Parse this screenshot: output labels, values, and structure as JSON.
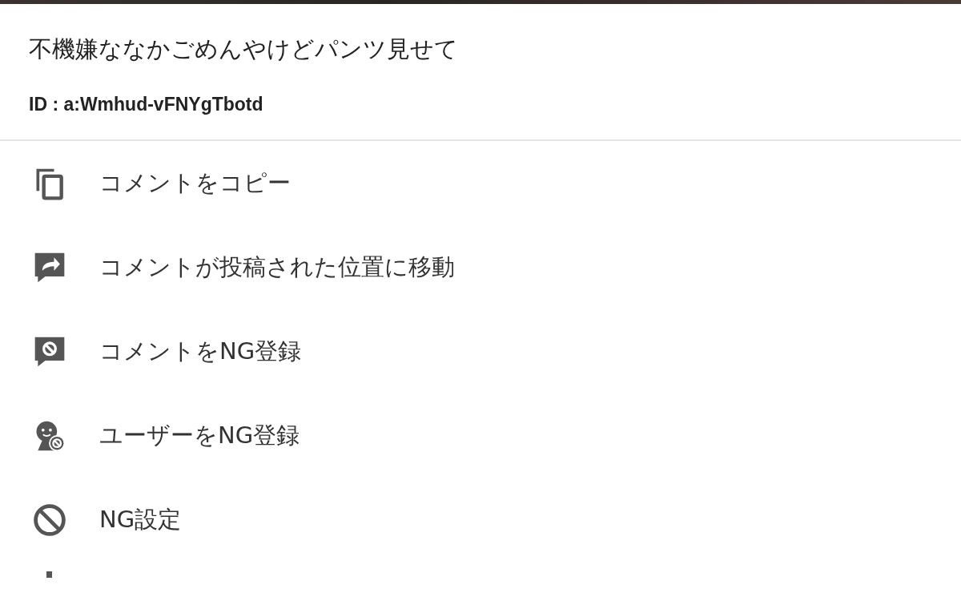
{
  "comment": {
    "text": "不機嫌ななかごめんやけどパンツ見せて",
    "id": "ID : a:Wmhud-vFNYgTbotd"
  },
  "menu": [
    {
      "kind": "copy",
      "label": "コメントをコピー"
    },
    {
      "kind": "jump",
      "label": "コメントが投稿された位置に移動"
    },
    {
      "kind": "ng-comment",
      "label": "コメントをNG登録"
    },
    {
      "kind": "ng-user",
      "label": "ユーザーをNG登録"
    },
    {
      "kind": "ng-settings",
      "label": "NG設定"
    }
  ]
}
